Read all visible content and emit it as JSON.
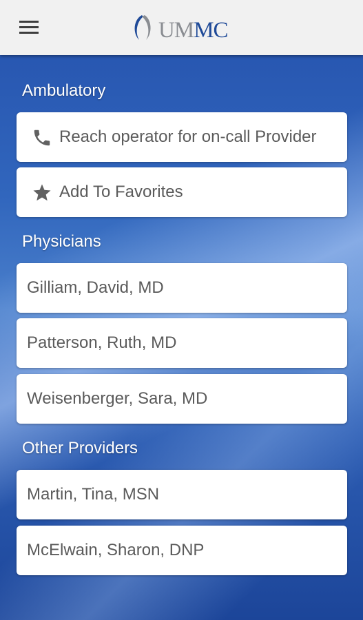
{
  "header": {
    "logo_text_um": "UM",
    "logo_text_mc": "MC"
  },
  "sections": [
    {
      "title": "Ambulatory",
      "items": [
        {
          "label": "Reach operator for on-call Provider",
          "icon": "phone-icon"
        },
        {
          "label": "Add To Favorites",
          "icon": "star-icon"
        }
      ]
    },
    {
      "title": "Physicians",
      "items": [
        {
          "label": "Gilliam, David, MD"
        },
        {
          "label": "Patterson, Ruth, MD"
        },
        {
          "label": "Weisenberger, Sara, MD"
        }
      ]
    },
    {
      "title": "Other Providers",
      "items": [
        {
          "label": "Martin, Tina, MSN"
        },
        {
          "label": "McElwain, Sharon, DNP"
        }
      ]
    }
  ],
  "colors": {
    "app_bar": "#f1f1f1",
    "background_blue": "#2e5fb5",
    "card": "#ffffff",
    "logo_blue": "#1f4a98",
    "logo_gray": "#8a8d92"
  }
}
